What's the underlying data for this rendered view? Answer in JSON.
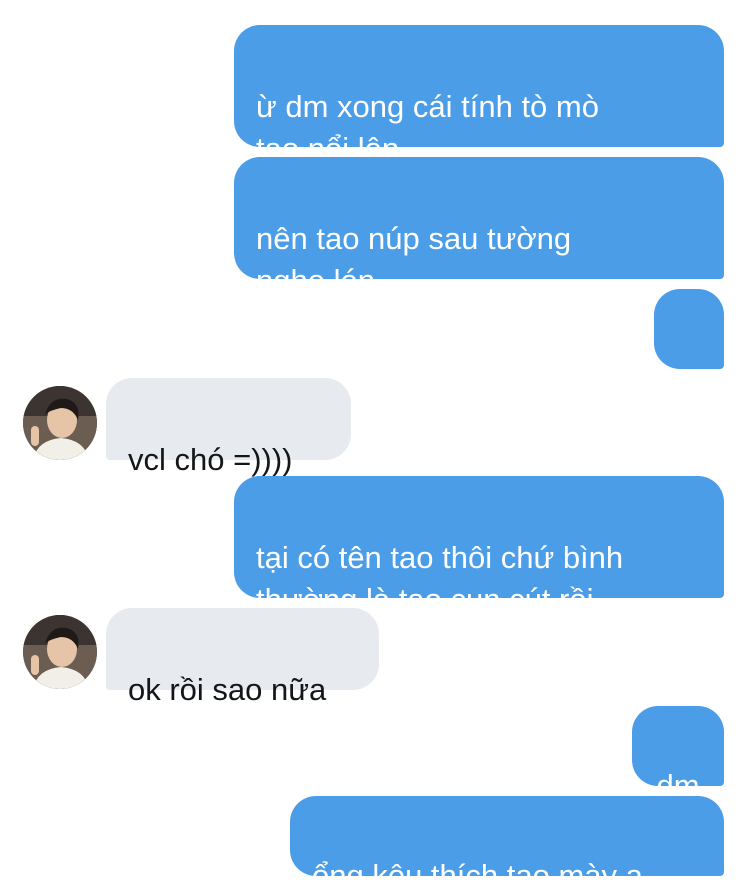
{
  "conversation": {
    "messages": [
      {
        "side": "out",
        "text": "ừ dm xong cái tính tò mò\ntao nổi lên"
      },
      {
        "side": "out",
        "text": "nên tao núp sau tường\nnghe lén"
      },
      {
        "side": "out",
        "text": "..."
      },
      {
        "side": "in",
        "text": "vcl chó =))))"
      },
      {
        "side": "out",
        "text": "tại có tên tao thôi chứ bình\nthường là tao cun cút rồi"
      },
      {
        "side": "in",
        "text": "ok rồi sao nữa"
      },
      {
        "side": "out",
        "text": "dm"
      },
      {
        "side": "out",
        "text": "ổng kêu thích tao mày ạ"
      }
    ]
  },
  "colors": {
    "outgoing_bubble": "#4b9de8",
    "incoming_bubble": "#e7ebef",
    "outgoing_text": "#ffffff",
    "incoming_text": "#14171a"
  },
  "icons": {
    "avatar": "contact-avatar-photo"
  }
}
